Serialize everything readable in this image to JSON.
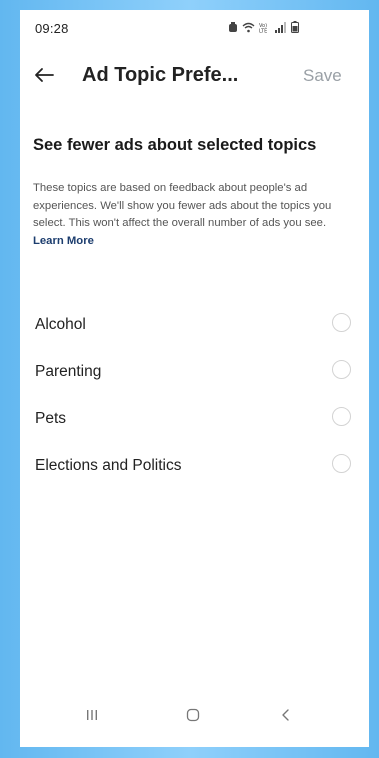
{
  "status_bar": {
    "time": "09:28",
    "icons": [
      "alarm-icon",
      "wifi-icon",
      "volte-icon",
      "signal-icon",
      "battery-icon"
    ],
    "volte_text": "Vo)\nLTE"
  },
  "header": {
    "title": "Ad Topic Prefe...",
    "save_label": "Save"
  },
  "section": {
    "heading": "See fewer ads about selected topics",
    "description": "These topics are based on feedback about people's ad experiences. We'll show you fewer ads about the topics you select. This won't affect the overall number of ads you see.",
    "learn_more": "Learn More"
  },
  "topics": [
    {
      "label": "Alcohol",
      "selected": false
    },
    {
      "label": "Parenting",
      "selected": false
    },
    {
      "label": "Pets",
      "selected": false
    },
    {
      "label": "Elections and Politics",
      "selected": false
    }
  ],
  "nav_bar": {
    "icons": [
      "recent-apps-icon",
      "home-icon",
      "back-nav-icon"
    ]
  },
  "colors": {
    "background": "#62b7f0",
    "text": "#222222",
    "link": "#1c3d6e",
    "disabled": "#9aa0a6",
    "radio_border": "#d3d3d3"
  }
}
